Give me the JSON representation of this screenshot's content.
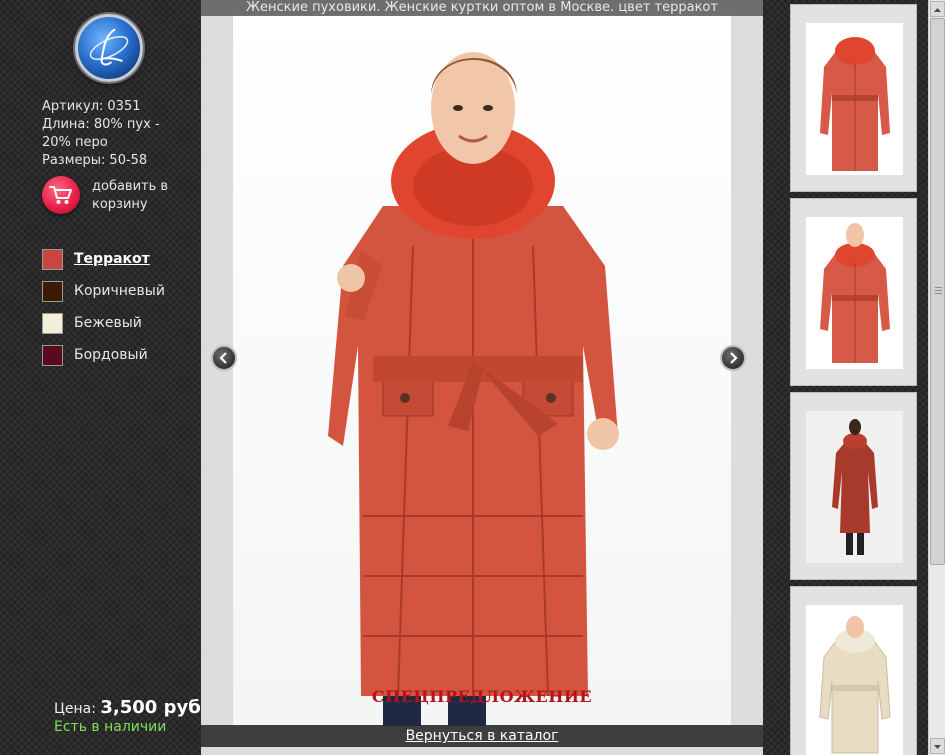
{
  "page_title": "Женские пуховики. Женские куртки оптом в Москве. цвет терракот",
  "logo": {
    "icon": "brand-logo-icon",
    "letter": "L"
  },
  "product": {
    "article": {
      "label": "Артикул:",
      "value": "0351"
    },
    "length_text": "Длина: 80% пух - 20% перо",
    "sizes": {
      "label": "Размеры:",
      "value": "50-58"
    }
  },
  "cart": {
    "icon": "shopping-cart-icon",
    "label": "добавить в корзину"
  },
  "colors": [
    {
      "name": "Терракот",
      "hex": "#c8463e",
      "active": true
    },
    {
      "name": "Коричневый",
      "hex": "#3c1a06",
      "active": false
    },
    {
      "name": "Бежевый",
      "hex": "#f3efd9",
      "active": false
    },
    {
      "name": "Бордовый",
      "hex": "#5a0a1c",
      "active": false
    }
  ],
  "price": {
    "label": "Цена:",
    "value": "3,500 руб."
  },
  "stock": "Есть в наличии",
  "viewer": {
    "special_offer": "СПЕЦПРЕДЛОЖЕНИЕ",
    "back_link": "Вернуться в каталог",
    "prev_icon": "chevron-left-icon",
    "next_icon": "chevron-right-icon"
  },
  "thumbnails": [
    {
      "view": "back",
      "coat_color": "#d65a47"
    },
    {
      "view": "front",
      "coat_color": "#d65a47"
    },
    {
      "view": "front-full",
      "coat_color": "#a83a2c"
    },
    {
      "view": "front",
      "coat_color": "#e8dcc3"
    }
  ],
  "colors_theme": {
    "accent_red": "#e8204a",
    "stock_green": "#7ee05a",
    "special_red": "#b5121b"
  }
}
